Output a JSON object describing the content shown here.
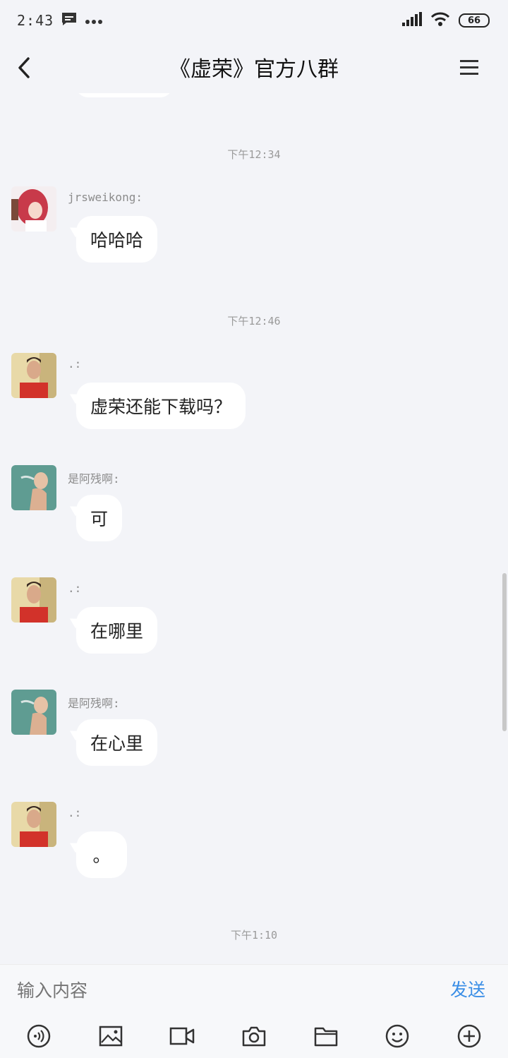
{
  "status_bar": {
    "time": "2:43",
    "battery": "66"
  },
  "header": {
    "title": "《虚荣》官方八群"
  },
  "messages": [
    {
      "type": "time",
      "text": "下午12:34"
    },
    {
      "type": "msg",
      "sender": "jrsweikong:",
      "text": "哈哈哈",
      "avatar": "anime-girl-avatar"
    },
    {
      "type": "time",
      "text": "下午12:46"
    },
    {
      "type": "msg",
      "sender": ".:",
      "text": "虚荣还能下载吗？",
      "avatar": "man-red-shirt-avatar"
    },
    {
      "type": "msg",
      "sender": "是阿残啊:",
      "text": "可",
      "avatar": "woman-smoking-avatar"
    },
    {
      "type": "msg",
      "sender": ".:",
      "text": "在哪里",
      "avatar": "man-red-shirt-avatar"
    },
    {
      "type": "msg",
      "sender": "是阿残啊:",
      "text": "在心里",
      "avatar": "woman-smoking-avatar"
    },
    {
      "type": "msg",
      "sender": ".:",
      "text": "。",
      "avatar": "man-red-shirt-avatar"
    },
    {
      "type": "time",
      "text": "下午1:10"
    }
  ],
  "input": {
    "placeholder": "输入内容",
    "send_label": "发送"
  },
  "toolbar": {
    "icons": [
      "voice-icon",
      "image-icon",
      "video-icon",
      "camera-icon",
      "folder-icon",
      "emoji-icon",
      "add-icon"
    ]
  },
  "colors": {
    "background": "#f3f4f8",
    "bubble": "#ffffff",
    "send": "#3a8ee6"
  }
}
